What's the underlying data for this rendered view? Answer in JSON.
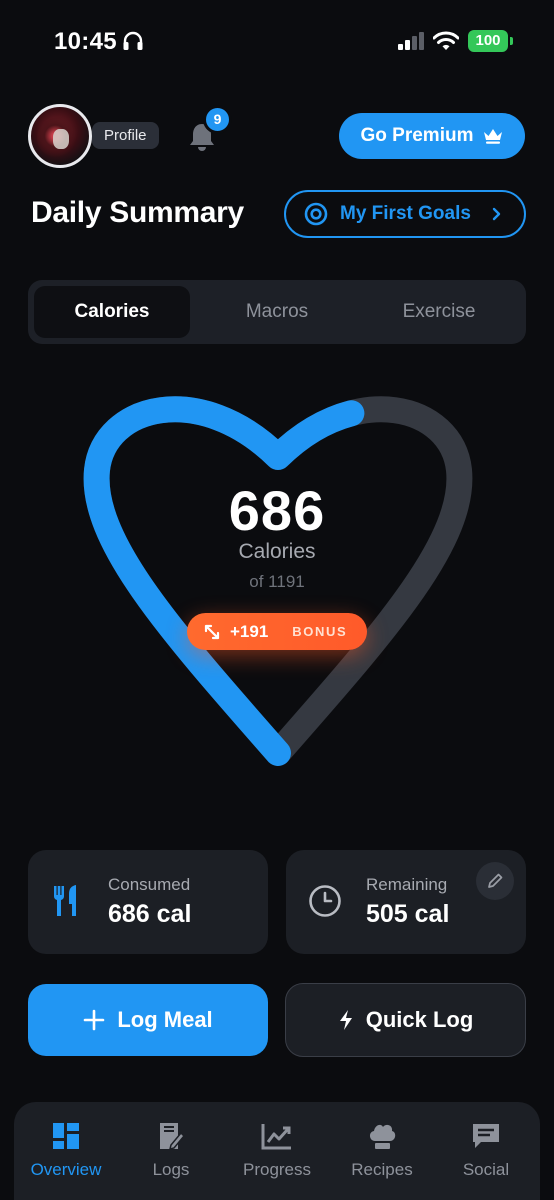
{
  "status": {
    "time": "10:45",
    "battery": "100"
  },
  "header": {
    "profile_label": "Profile",
    "notifications_count": "9",
    "premium_label": "Go Premium"
  },
  "summary": {
    "title": "Daily Summary",
    "goals_label": "My First Goals"
  },
  "tabs": [
    {
      "label": "Calories"
    },
    {
      "label": "Macros"
    },
    {
      "label": "Exercise"
    }
  ],
  "calories": {
    "consumed_value": "686",
    "label": "Calories",
    "of_text": "of 1191",
    "progress": 0.576,
    "bonus_amount": "+191",
    "bonus_label": "BONUS"
  },
  "stats": {
    "consumed": {
      "caption": "Consumed",
      "value": "686 cal"
    },
    "remaining": {
      "caption": "Remaining",
      "value": "505 cal"
    }
  },
  "actions": {
    "log_meal": "Log Meal",
    "quick_log": "Quick Log"
  },
  "nav": [
    {
      "label": "Overview",
      "icon": "dashboard-icon"
    },
    {
      "label": "Logs",
      "icon": "log-book-icon"
    },
    {
      "label": "Progress",
      "icon": "chart-icon"
    },
    {
      "label": "Recipes",
      "icon": "chef-hat-icon"
    },
    {
      "label": "Social",
      "icon": "chat-icon"
    }
  ],
  "colors": {
    "accent": "#2196f3",
    "bonus": "#ff5a2a",
    "track": "#353941",
    "background": "#0b0c0f"
  }
}
